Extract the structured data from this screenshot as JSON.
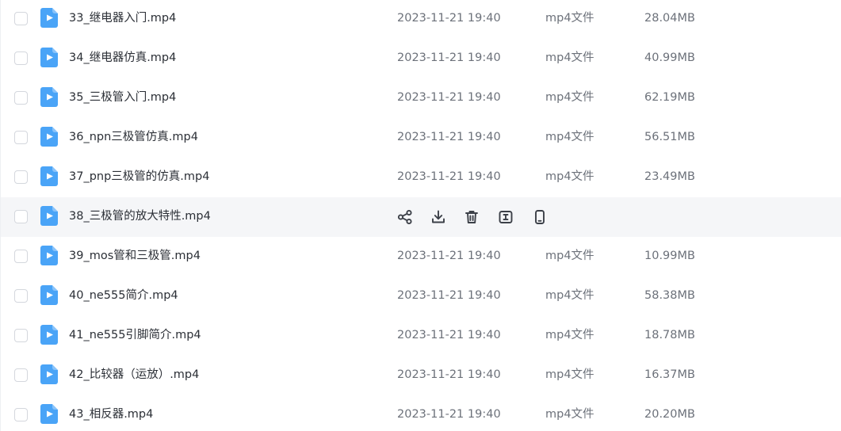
{
  "files": [
    {
      "name": "33_继电器入门.mp4",
      "date": "2023-11-21 19:40",
      "type": "mp4文件",
      "size": "28.04MB"
    },
    {
      "name": "34_继电器仿真.mp4",
      "date": "2023-11-21 19:40",
      "type": "mp4文件",
      "size": "40.99MB"
    },
    {
      "name": "35_三极管入门.mp4",
      "date": "2023-11-21 19:40",
      "type": "mp4文件",
      "size": "62.19MB"
    },
    {
      "name": "36_npn三极管仿真.mp4",
      "date": "2023-11-21 19:40",
      "type": "mp4文件",
      "size": "56.51MB"
    },
    {
      "name": "37_pnp三极管的仿真.mp4",
      "date": "2023-11-21 19:40",
      "type": "mp4文件",
      "size": "23.49MB"
    },
    {
      "name": "38_三极管的放大特性.mp4",
      "hovered": true
    },
    {
      "name": "39_mos管和三极管.mp4",
      "date": "2023-11-21 19:40",
      "type": "mp4文件",
      "size": "10.99MB"
    },
    {
      "name": "40_ne555简介.mp4",
      "date": "2023-11-21 19:40",
      "type": "mp4文件",
      "size": "58.38MB"
    },
    {
      "name": "41_ne555引脚简介.mp4",
      "date": "2023-11-21 19:40",
      "type": "mp4文件",
      "size": "18.78MB"
    },
    {
      "name": "42_比较器（运放）.mp4",
      "date": "2023-11-21 19:40",
      "type": "mp4文件",
      "size": "16.37MB"
    },
    {
      "name": "43_相反器.mp4",
      "date": "2023-11-21 19:40",
      "type": "mp4文件",
      "size": "20.20MB"
    }
  ],
  "row_actions": [
    {
      "icon": "share-icon"
    },
    {
      "icon": "download-icon"
    },
    {
      "icon": "delete-icon"
    },
    {
      "icon": "rename-icon"
    },
    {
      "icon": "phone-icon"
    }
  ],
  "colors": {
    "video_icon": "#4aa4f7",
    "hover_row": "#f5f6f8",
    "action_icon": "#3c4048"
  }
}
